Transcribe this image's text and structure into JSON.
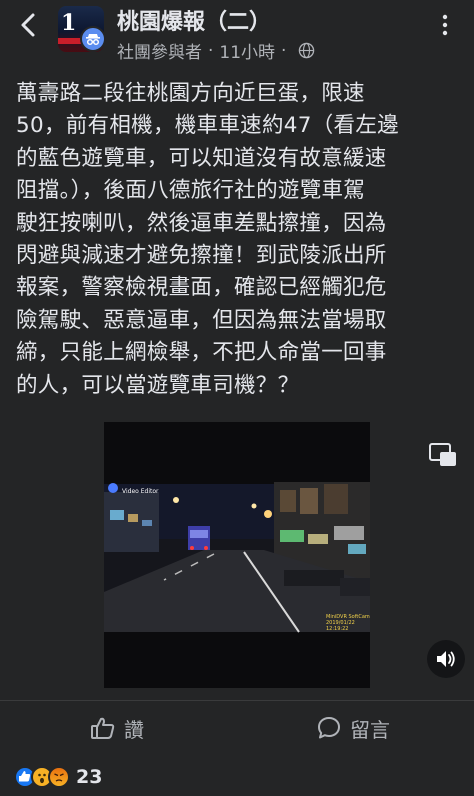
{
  "header": {
    "group_name": "桃園爆報（二）",
    "role": "社團參與者",
    "separator": "·",
    "time": "11小時",
    "avatar_digit": "1"
  },
  "post": {
    "text": "萬壽路二段往桃園方向近巨蛋，限速\n50，前有相機，機車車速約47（看左邊\n的藍色遊覽車，可以知道沒有故意緩速\n阻擋。），後面八德旅行社的遊覽車駕\n駛狂按喇叭，然後逼車差點擦撞，因為\n閃避與減速才避免擦撞！到武陵派出所\n報案，警察檢視畫面，確認已經觸犯危\n險駕駛、惡意逼車，但因為無法當場取\n締，只能上網檢舉，不把人命當一回事\n的人，可以當遊覽車司機？？"
  },
  "video": {
    "editor_label": "Video Editor",
    "watermark_line1": "MiniDVR SoftCam",
    "watermark_line2": "2019/01/22 12:19:22"
  },
  "actions": {
    "like_label": "讚",
    "comment_label": "留言"
  },
  "reactions": {
    "count": "23",
    "types": [
      "like-icon",
      "wow-icon",
      "angry-icon"
    ]
  },
  "colors": {
    "background": "#242526",
    "text": "#e4e6eb",
    "secondary_text": "#b0b3b8",
    "like_blue": "#1877f2"
  }
}
